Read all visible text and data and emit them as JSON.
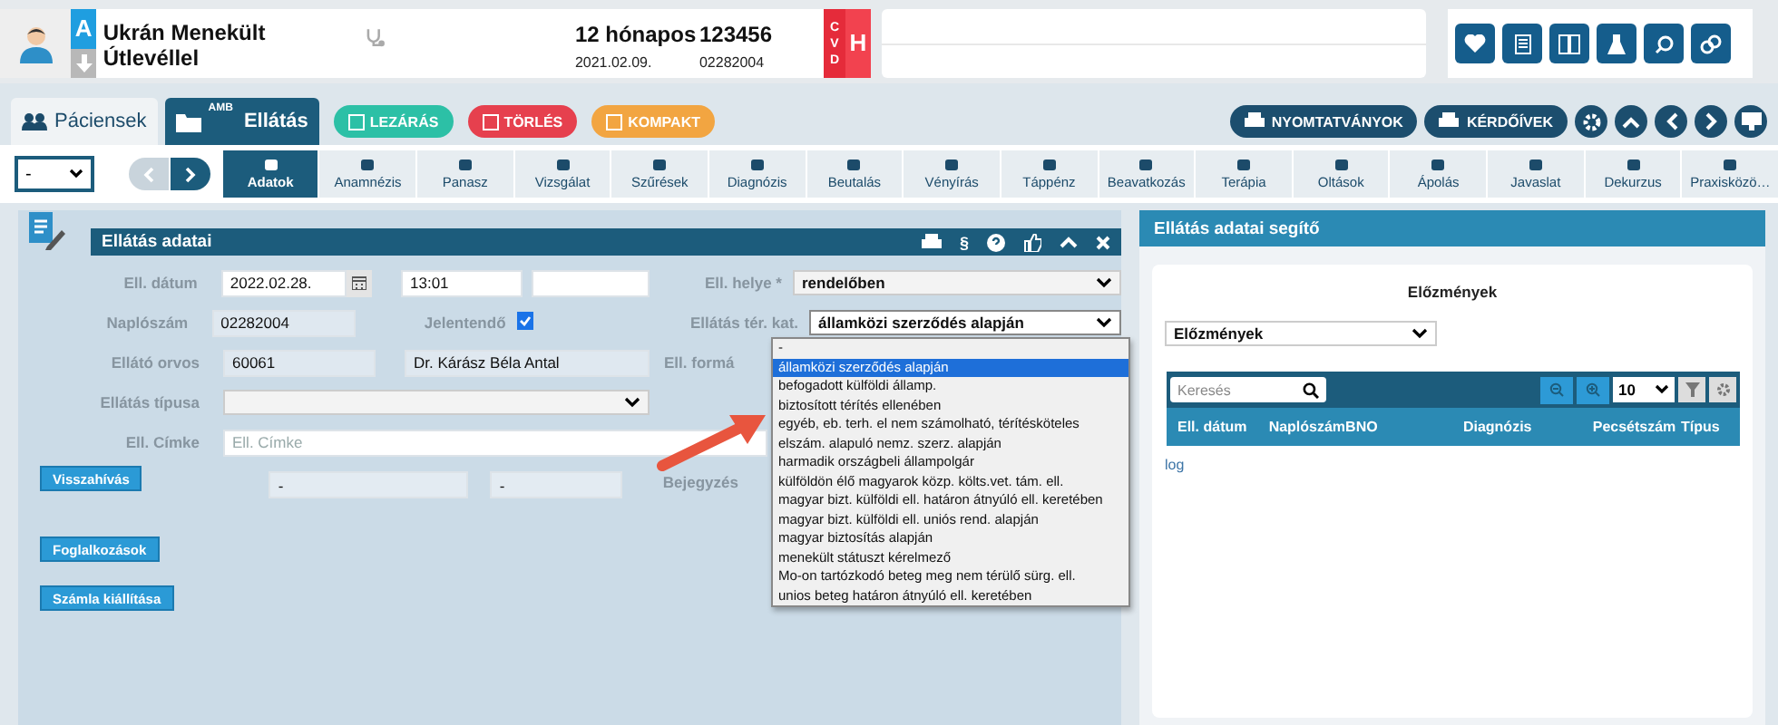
{
  "patient": {
    "initial": "A",
    "name": "Ukrán Menekült Útlevéllel",
    "age": "12 hónapos",
    "date": "2021.02.09.",
    "id": "123456",
    "number": "02282004",
    "flags": [
      "C",
      "V",
      "D"
    ],
    "flag_big": "H"
  },
  "main_tabs": [
    {
      "label": "Páciensek",
      "selected": false
    },
    {
      "label": "Ellátás",
      "badge": "AMB",
      "selected": true
    }
  ],
  "actions": [
    {
      "label": "LEZÁRÁS",
      "color": "#2cc0a6"
    },
    {
      "label": "TÖRLÉS",
      "color": "#e6404e"
    },
    {
      "label": "KOMPAKT",
      "color": "#f2a541"
    }
  ],
  "right_buttons": [
    "NYOMTATVÁNYOK",
    "KÉRDŐÍVEK"
  ],
  "nav_select": "-",
  "sections": [
    {
      "label": "Adatok",
      "selected": true
    },
    {
      "label": "Anamnézis",
      "selected": false
    },
    {
      "label": "Panasz",
      "selected": false
    },
    {
      "label": "Vizsgálat",
      "selected": false
    },
    {
      "label": "Szűrések",
      "selected": false
    },
    {
      "label": "Diagnózis",
      "selected": false
    },
    {
      "label": "Beutalás",
      "selected": false
    },
    {
      "label": "Vényírás",
      "selected": false
    },
    {
      "label": "Táppénz",
      "selected": false
    },
    {
      "label": "Beavatkozás",
      "selected": false
    },
    {
      "label": "Terápia",
      "selected": false
    },
    {
      "label": "Oltások",
      "selected": false
    },
    {
      "label": "Ápolás",
      "selected": false
    },
    {
      "label": "Javaslat",
      "selected": false
    },
    {
      "label": "Dekurzus",
      "selected": false
    },
    {
      "label": "Praxisközö…",
      "selected": false
    }
  ],
  "form": {
    "title": "Ellátás adatai",
    "section_mark": "§",
    "date_label": "Ell. dátum",
    "date": "2022.02.28.",
    "time": "13:01",
    "place_label": "Ell. helye *",
    "place": "rendelőben",
    "log_label": "Naplószám",
    "log": "02282004",
    "report_label": "Jelentendő",
    "report_checked": true,
    "category_label": "Ellátás tér. kat.",
    "category": "államközi szerződés alapján",
    "doctor_label": "Ellátó orvos",
    "doctor_code": "60061",
    "doctor_name": "Dr. Kárász Béla Antal",
    "form_label": "Ell. formá",
    "type_label": "Ellátás típusa",
    "tag_label": "Ell. Címke",
    "tag_placeholder": "Ell. Címke",
    "field_a": "-",
    "field_b": "-",
    "entry_label": "Bejegyzés"
  },
  "dropdown": [
    {
      "label": "-",
      "selected": false
    },
    {
      "label": "államközi szerződés alapján",
      "selected": true
    },
    {
      "label": "befogadott külföldi államp.",
      "selected": false
    },
    {
      "label": "biztosított térítés ellenében",
      "selected": false
    },
    {
      "label": "egyéb, eb. terh. el nem számolható, térítésköteles",
      "selected": false
    },
    {
      "label": "elszám. alapuló nemz. szerz. alapján",
      "selected": false
    },
    {
      "label": "harmadik országbeli állampolgár",
      "selected": false
    },
    {
      "label": "külföldön élő magyarok közp. költs.vet. tám. ell.",
      "selected": false
    },
    {
      "label": "magyar bizt. külföldi ell. határon átnyúló ell. keretében",
      "selected": false
    },
    {
      "label": "magyar bizt. külföldi ell. uniós rend. alapján",
      "selected": false
    },
    {
      "label": "magyar biztosítás alapján",
      "selected": false
    },
    {
      "label": "menekült státuszt kérelmező",
      "selected": false
    },
    {
      "label": "Mo-on tartózkodó beteg meg nem térülő sürg. ell.",
      "selected": false
    },
    {
      "label": "unios beteg határon átnyúló ell. keretében",
      "selected": false
    }
  ],
  "buttons": [
    "Visszahívás",
    "Foglalkozások",
    "Számla kiállítása"
  ],
  "helper": {
    "title": "Ellátás adatai segítő",
    "subtitle": "Előzmények",
    "select": "Előzmények",
    "search_placeholder": "Keresés",
    "page_size": "10",
    "columns": [
      "Ell. dátum",
      "Naplószám",
      "BNO",
      "Diagnózis",
      "Pecsétszám",
      "Típus"
    ],
    "link": "log"
  }
}
